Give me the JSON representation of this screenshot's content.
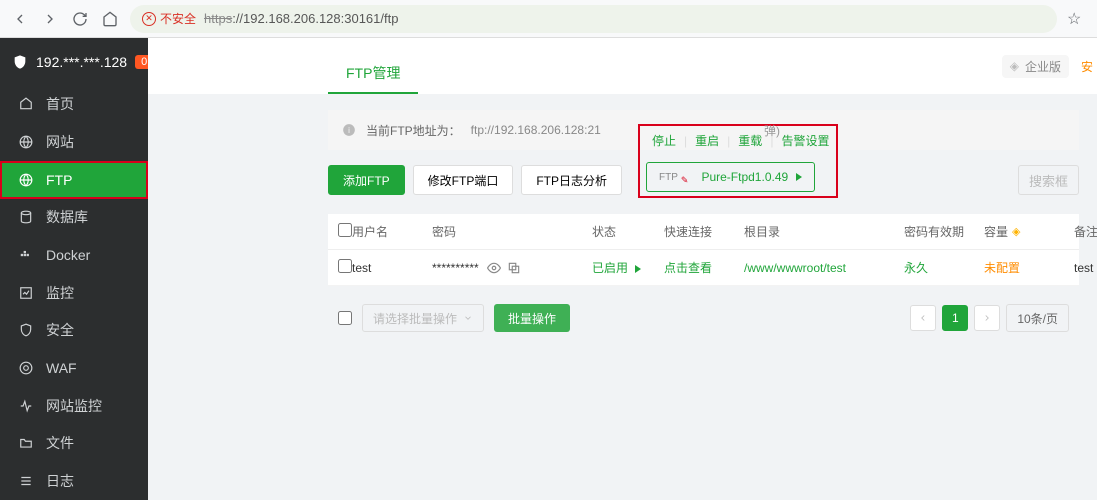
{
  "browser": {
    "insecure_label": "不安全",
    "url_protocol": "https",
    "url_host_path": "://192.168.206.128:30161/ftp"
  },
  "sidebar": {
    "server_ip": "192.***.***.128",
    "notif_count": "0",
    "items": [
      {
        "label": "首页",
        "icon": "home-icon"
      },
      {
        "label": "网站",
        "icon": "globe-icon"
      },
      {
        "label": "FTP",
        "icon": "globe-icon"
      },
      {
        "label": "数据库",
        "icon": "database-icon"
      },
      {
        "label": "Docker",
        "icon": "docker-icon"
      },
      {
        "label": "监控",
        "icon": "chart-icon"
      },
      {
        "label": "安全",
        "icon": "shield-icon"
      },
      {
        "label": "WAF",
        "icon": "aperture-icon"
      },
      {
        "label": "网站监控",
        "icon": "wave-icon"
      },
      {
        "label": "文件",
        "icon": "folder-icon"
      },
      {
        "label": "日志",
        "icon": "list-icon"
      }
    ]
  },
  "tabs": {
    "ftp_tab": "FTP管理",
    "edition": "企业版",
    "safety": "安"
  },
  "url_row": {
    "label": "当前FTP地址为：",
    "value": "ftp://192.168.206.128:21",
    "trailing": "弹)"
  },
  "actions": {
    "stop": "停止",
    "restart": "重启",
    "reload": "重载",
    "alarm": "告警设置"
  },
  "toolbar": {
    "add_ftp": "添加FTP",
    "change_port": "修改FTP端口",
    "log_analyze": "FTP日志分析",
    "ftp_mini": "FTP",
    "version": "Pure-Ftpd1.0.49",
    "search_placeholder": "搜索框"
  },
  "thead": {
    "user": "用户名",
    "pass": "密码",
    "status": "状态",
    "quick": "快速连接",
    "root": "根目录",
    "expire": "密码有效期",
    "cap": "容量",
    "note": "备注"
  },
  "rows": [
    {
      "user": "test",
      "pass_mask": "**********",
      "status": "已启用",
      "quick": "点击查看",
      "root": "/www/wwwroot/test",
      "expire": "永久",
      "cap": "未配置",
      "note": "test"
    }
  ],
  "footer": {
    "batch_placeholder": "请选择批量操作",
    "batch_button": "批量操作",
    "page": "1",
    "page_size": "10条/页"
  }
}
